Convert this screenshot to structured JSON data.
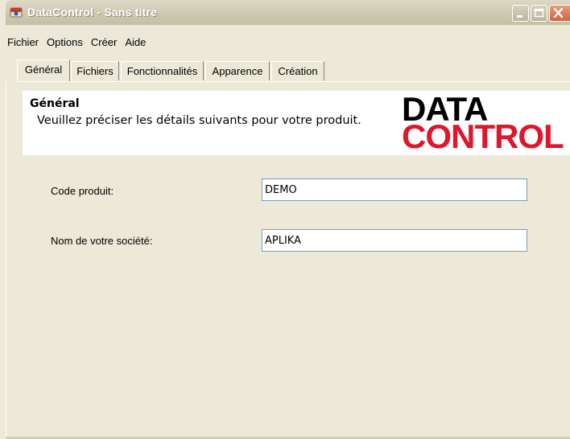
{
  "window": {
    "title": "DataControl - Sans titre"
  },
  "menu": [
    "Fichier",
    "Options",
    "Créer",
    "Aide"
  ],
  "tabs": [
    {
      "label": "Général",
      "active": true
    },
    {
      "label": "Fichiers",
      "active": false
    },
    {
      "label": "Fonctionnalités",
      "active": false
    },
    {
      "label": "Apparence",
      "active": false
    },
    {
      "label": "Création",
      "active": false
    }
  ],
  "header": {
    "title": "Général",
    "description": "Veuillez préciser les détails suivants pour votre produit.",
    "logo_line1": "DATA",
    "logo_line2": "CONTROL",
    "logo_color": "#e0162b"
  },
  "form": {
    "code_label": "Code produit:",
    "code_value": "DEMO",
    "company_label": "Nom de votre société:",
    "company_value": "APLIKA"
  },
  "icons": {
    "app": "datacontrol-app-icon",
    "minimize": "minimize-icon",
    "maximize": "maximize-icon",
    "close": "close-icon"
  }
}
